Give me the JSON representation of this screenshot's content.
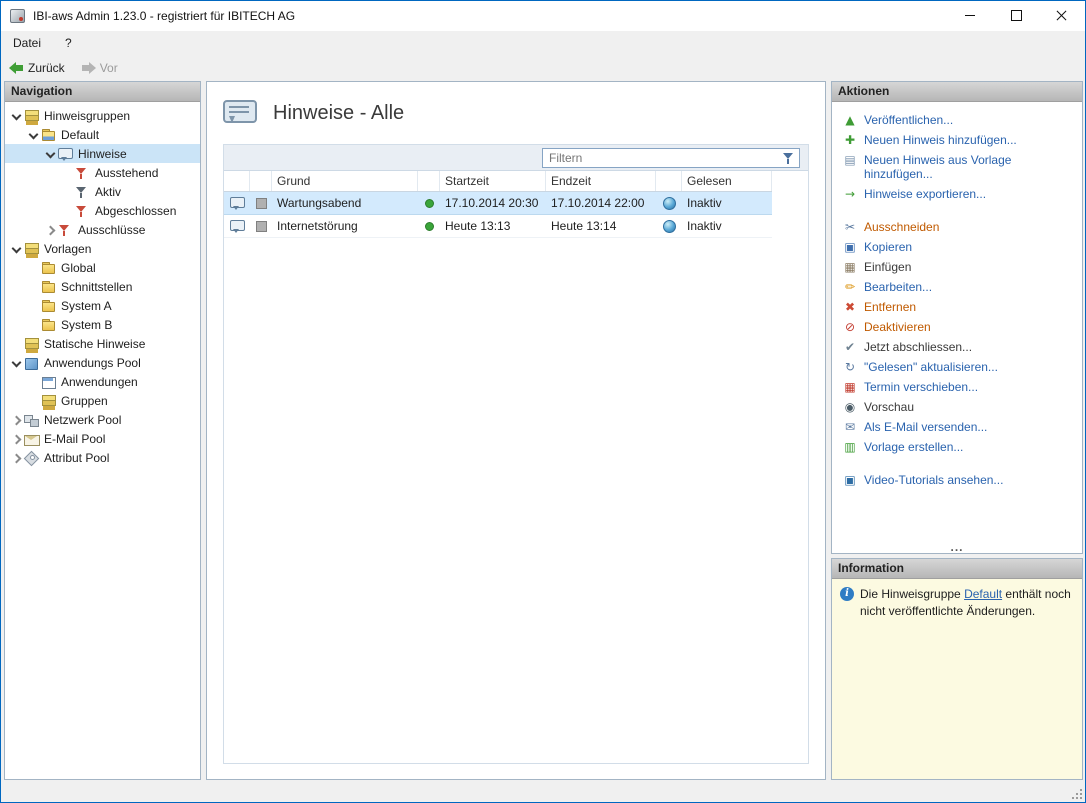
{
  "window": {
    "title": "IBI-aws Admin 1.23.0 - registriert für IBITECH AG"
  },
  "menu": {
    "items": [
      {
        "label": "Datei"
      },
      {
        "label": "?"
      }
    ]
  },
  "toolbar": {
    "back_label": "Zurück",
    "forward_label": "Vor"
  },
  "navigation": {
    "header": "Navigation",
    "tree": [
      {
        "label": "Hinweisgruppen",
        "level": 0,
        "expander": "expanded",
        "icon": "layers",
        "selected": false
      },
      {
        "label": "Default",
        "level": 1,
        "expander": "expanded",
        "icon": "group-folder",
        "selected": false
      },
      {
        "label": "Hinweise",
        "level": 2,
        "expander": "expanded",
        "icon": "bubble",
        "selected": true
      },
      {
        "label": "Ausstehend",
        "level": 3,
        "expander": "none",
        "icon": "funnel-red",
        "selected": false
      },
      {
        "label": "Aktiv",
        "level": 3,
        "expander": "none",
        "icon": "funnel-dark",
        "selected": false
      },
      {
        "label": "Abgeschlossen",
        "level": 3,
        "expander": "none",
        "icon": "funnel-red",
        "selected": false
      },
      {
        "label": "Ausschlüsse",
        "level": 2,
        "expander": "collapsed",
        "icon": "funnel-red",
        "selected": false
      },
      {
        "label": "Vorlagen",
        "level": 0,
        "expander": "expanded",
        "icon": "layers",
        "selected": false
      },
      {
        "label": "Global",
        "level": 1,
        "expander": "none",
        "icon": "folder",
        "selected": false
      },
      {
        "label": "Schnittstellen",
        "level": 1,
        "expander": "none",
        "icon": "folder",
        "selected": false
      },
      {
        "label": "System A",
        "level": 1,
        "expander": "none",
        "icon": "folder",
        "selected": false
      },
      {
        "label": "System B",
        "level": 1,
        "expander": "none",
        "icon": "folder",
        "selected": false
      },
      {
        "label": "Statische Hinweise",
        "level": 0,
        "expander": "none",
        "icon": "layers",
        "selected": false
      },
      {
        "label": "Anwendungs Pool",
        "level": 0,
        "expander": "expanded",
        "icon": "pool",
        "selected": false
      },
      {
        "label": "Anwendungen",
        "level": 1,
        "expander": "none",
        "icon": "app-window",
        "selected": false
      },
      {
        "label": "Gruppen",
        "level": 1,
        "expander": "none",
        "icon": "layers",
        "selected": false
      },
      {
        "label": "Netzwerk Pool",
        "level": 0,
        "expander": "collapsed",
        "icon": "network",
        "selected": false
      },
      {
        "label": "E-Mail Pool",
        "level": 0,
        "expander": "collapsed",
        "icon": "mail",
        "selected": false
      },
      {
        "label": "Attribut Pool",
        "level": 0,
        "expander": "collapsed",
        "icon": "tag",
        "selected": false
      }
    ]
  },
  "main": {
    "title": "Hinweise - Alle",
    "filter": {
      "placeholder": "Filtern"
    },
    "table": {
      "columns": {
        "grund": "Grund",
        "startzeit": "Startzeit",
        "endzeit": "Endzeit",
        "gelesen": "Gelesen"
      },
      "rows": [
        {
          "grund": "Wartungsabend",
          "startzeit": "17.10.2014 20:30",
          "endzeit": "17.10.2014 22:00",
          "gelesen": "Inaktiv",
          "status_color": "#3aa53a",
          "selected": true
        },
        {
          "grund": "Internetstörung",
          "startzeit": "Heute 13:13",
          "endzeit": "Heute 13:14",
          "gelesen": "Inaktiv",
          "status_color": "#3aa53a",
          "selected": false
        }
      ]
    }
  },
  "actions": {
    "header": "Aktionen",
    "more_indicator": "...",
    "items": [
      {
        "label": "Veröffentlichen...",
        "icon": "publish-icon",
        "glyph": "▲",
        "icon_color": "#3f9c35",
        "color": "#2a63ae",
        "group_start": false
      },
      {
        "label": "Neuen Hinweis hinzufügen...",
        "icon": "add-hinweis-icon",
        "glyph": "✚",
        "icon_color": "#3f9c35",
        "color": "#2a63ae",
        "group_start": false
      },
      {
        "label": "Neuen Hinweis aus Vorlage hinzufügen...",
        "icon": "add-from-template-icon",
        "glyph": "▤",
        "icon_color": "#7a93ad",
        "color": "#2a63ae",
        "group_start": false
      },
      {
        "label": "Hinweise exportieren...",
        "icon": "export-icon",
        "glyph": "→",
        "icon_color": "#3f9c35",
        "color": "#2a63ae",
        "group_start": false
      },
      {
        "label": "Ausschneiden",
        "icon": "cut-icon",
        "glyph": "✂",
        "icon_color": "#5b7aa0",
        "color": "#c05a00",
        "group_start": true
      },
      {
        "label": "Kopieren",
        "icon": "copy-icon",
        "glyph": "▣",
        "icon_color": "#3f6fae",
        "color": "#2a63ae",
        "group_start": false
      },
      {
        "label": "Einfügen",
        "icon": "paste-icon",
        "glyph": "▦",
        "icon_color": "#8a7b63",
        "color": "#3a3a3a",
        "group_start": false
      },
      {
        "label": "Bearbeiten...",
        "icon": "edit-icon",
        "glyph": "✏",
        "icon_color": "#d98c00",
        "color": "#2a63ae",
        "group_start": false
      },
      {
        "label": "Entfernen",
        "icon": "delete-icon",
        "glyph": "✖",
        "icon_color": "#cc4b35",
        "color": "#c05a00",
        "group_start": false
      },
      {
        "label": "Deaktivieren",
        "icon": "deactivate-icon",
        "glyph": "⊘",
        "icon_color": "#c23b2e",
        "color": "#c05a00",
        "group_start": false
      },
      {
        "label": "Jetzt abschliessen...",
        "icon": "complete-now-icon",
        "glyph": "✔",
        "icon_color": "#6f8291",
        "color": "#3a3a3a",
        "group_start": false
      },
      {
        "label": "\"Gelesen\" aktualisieren...",
        "icon": "refresh-read-icon",
        "glyph": "↻",
        "icon_color": "#5b7aa0",
        "color": "#2a63ae",
        "group_start": false
      },
      {
        "label": "Termin verschieben...",
        "icon": "reschedule-icon",
        "glyph": "▦",
        "icon_color": "#c0392b",
        "color": "#2a63ae",
        "group_start": false
      },
      {
        "label": "Vorschau",
        "icon": "preview-icon",
        "glyph": "◉",
        "icon_color": "#4a5b66",
        "color": "#3a3a3a",
        "group_start": false
      },
      {
        "label": "Als E-Mail versenden...",
        "icon": "send-email-icon",
        "glyph": "✉",
        "icon_color": "#5b7aa0",
        "color": "#2a63ae",
        "group_start": false
      },
      {
        "label": "Vorlage erstellen...",
        "icon": "create-template-icon",
        "glyph": "▥",
        "icon_color": "#3f9c35",
        "color": "#2a63ae",
        "group_start": false
      },
      {
        "label": "Video-Tutorials ansehen...",
        "icon": "video-tutorials-icon",
        "glyph": "▣",
        "icon_color": "#2e6da4",
        "color": "#2a63ae",
        "group_start": true
      }
    ]
  },
  "information": {
    "header": "Information",
    "text_before": "Die Hinweisgruppe ",
    "link_label": "Default",
    "text_after": " enthält noch nicht veröffentlichte Änderungen."
  },
  "colors": {
    "accent": "#0067c0",
    "tree_selection": "#cbe4f7",
    "row_selection": "#d3eafd",
    "link_blue": "#2a63ae",
    "info_background": "#fcfae1"
  }
}
